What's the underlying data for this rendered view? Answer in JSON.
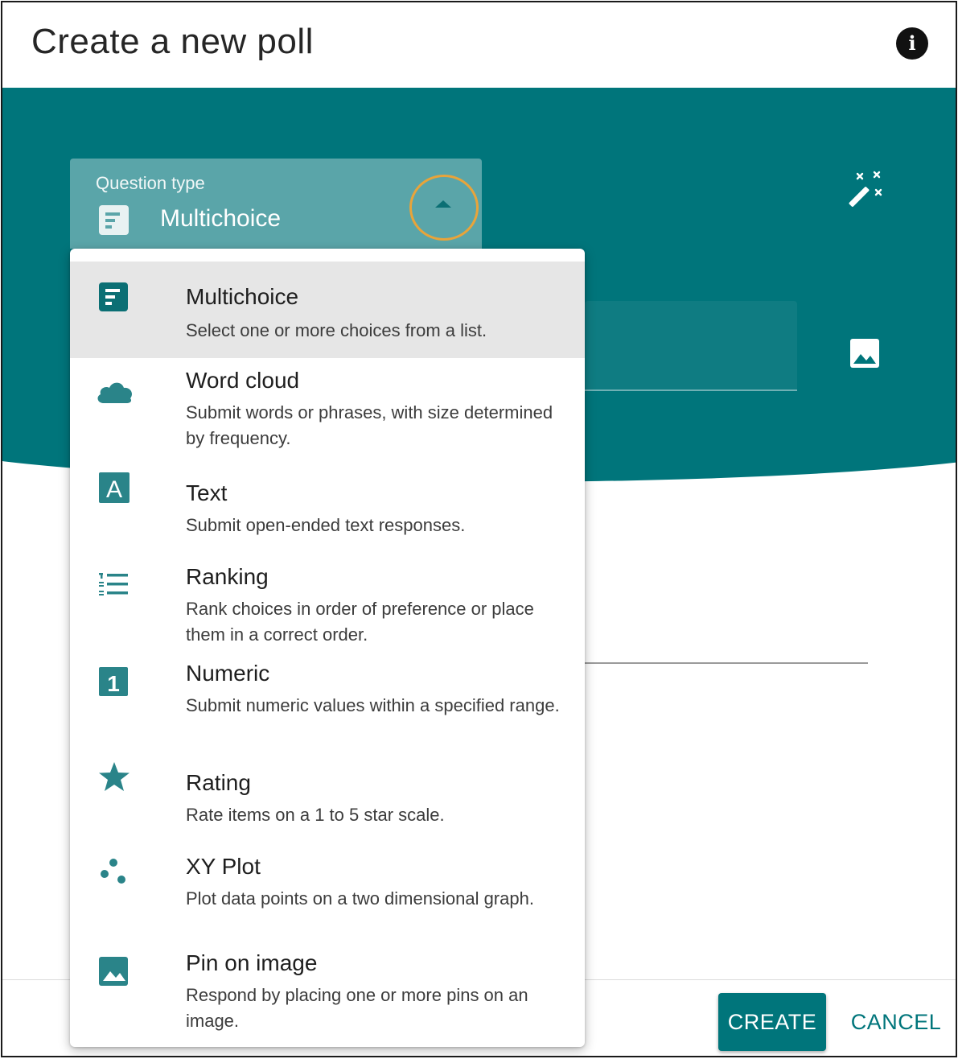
{
  "dialog": {
    "title": "Create a new poll",
    "info_icon": "info-icon",
    "info_glyph": "i"
  },
  "question_type": {
    "label": "Question type",
    "value": "Multichoice",
    "icon": "multichoice-icon",
    "toggle_icon": "caret-up-icon"
  },
  "toolbar": {
    "magic_icon": "magic-wand-icon",
    "image_icon": "image-icon"
  },
  "menu": {
    "items": [
      {
        "title": "Multichoice",
        "desc": "Select one or more choices from a list.",
        "icon": "multichoice-icon",
        "selected": true
      },
      {
        "title": "Word cloud",
        "desc": "Submit words or phrases, with size determined by frequency.",
        "icon": "cloud-icon"
      },
      {
        "title": "Text",
        "desc": "Submit open-ended text responses.",
        "icon": "text-icon",
        "glyph": "A"
      },
      {
        "title": "Ranking",
        "desc": "Rank choices in order of preference or place them in a correct order.",
        "icon": "ranking-icon"
      },
      {
        "title": "Numeric",
        "desc": "Submit numeric values within a specified range.",
        "icon": "numeric-icon",
        "glyph": "1"
      },
      {
        "title": "Rating",
        "desc": "Rate items on a 1 to 5 star scale.",
        "icon": "star-icon"
      },
      {
        "title": "XY Plot",
        "desc": "Plot data points on a two dimensional graph.",
        "icon": "scatter-icon"
      },
      {
        "title": "Pin on image",
        "desc": "Respond by placing one or more pins on an image.",
        "icon": "image-icon"
      }
    ]
  },
  "footer": {
    "create_label": "CREATE",
    "cancel_label": "CANCEL"
  },
  "colors": {
    "teal": "#00757b",
    "teal_light": "#5aa5a9",
    "highlight_ring": "#e8a43a",
    "selected_bg": "#e6e6e6"
  }
}
